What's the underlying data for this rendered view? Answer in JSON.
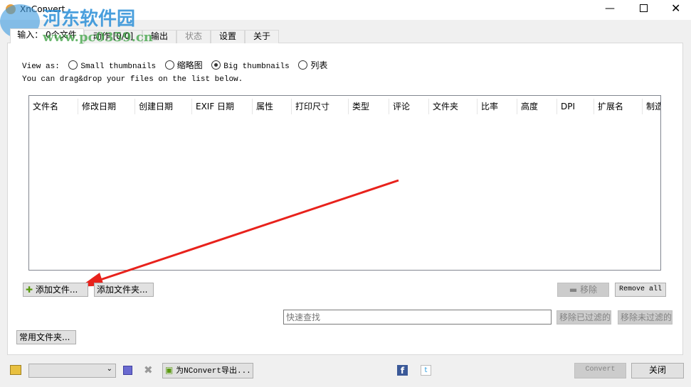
{
  "window": {
    "title": "XnConvert",
    "watermark": "河东软件园",
    "watermark_url": "www.pc0359.cn"
  },
  "tabs": [
    {
      "label": "输入： 0个文件",
      "active": true
    },
    {
      "label": "动作 [0/0]"
    },
    {
      "label": "输出"
    },
    {
      "label": "状态",
      "disabled": true
    },
    {
      "label": "设置"
    },
    {
      "label": "关于"
    }
  ],
  "view": {
    "label": "View as:",
    "options": [
      {
        "label": "Small thumbnails",
        "selected": false
      },
      {
        "label": "缩略图",
        "selected": false
      },
      {
        "label": "Big thumbnails",
        "selected": true
      },
      {
        "label": "列表",
        "selected": false
      }
    ],
    "hint": "You can drag&drop your files on the list below."
  },
  "columns": [
    "文件名",
    "修改日期",
    "创建日期",
    "EXIF 日期",
    "属性",
    "打印尺寸",
    "类型",
    "评论",
    "文件夹",
    "比率",
    "高度",
    "DPI",
    "扩展名",
    "制造"
  ],
  "buttons": {
    "add_files": "添加文件...",
    "add_folder": "添加文件夹...",
    "remove": "移除",
    "remove_all": "Remove all",
    "remove_filtered": "移除已过滤的",
    "remove_unfiltered": "移除未过滤的",
    "favorites": "常用文件夹...",
    "export": "为NConvert导出...",
    "convert": "Convert",
    "close": "关闭"
  },
  "search": {
    "placeholder": "快速查找",
    "value": ""
  },
  "preset": {
    "value": ""
  }
}
